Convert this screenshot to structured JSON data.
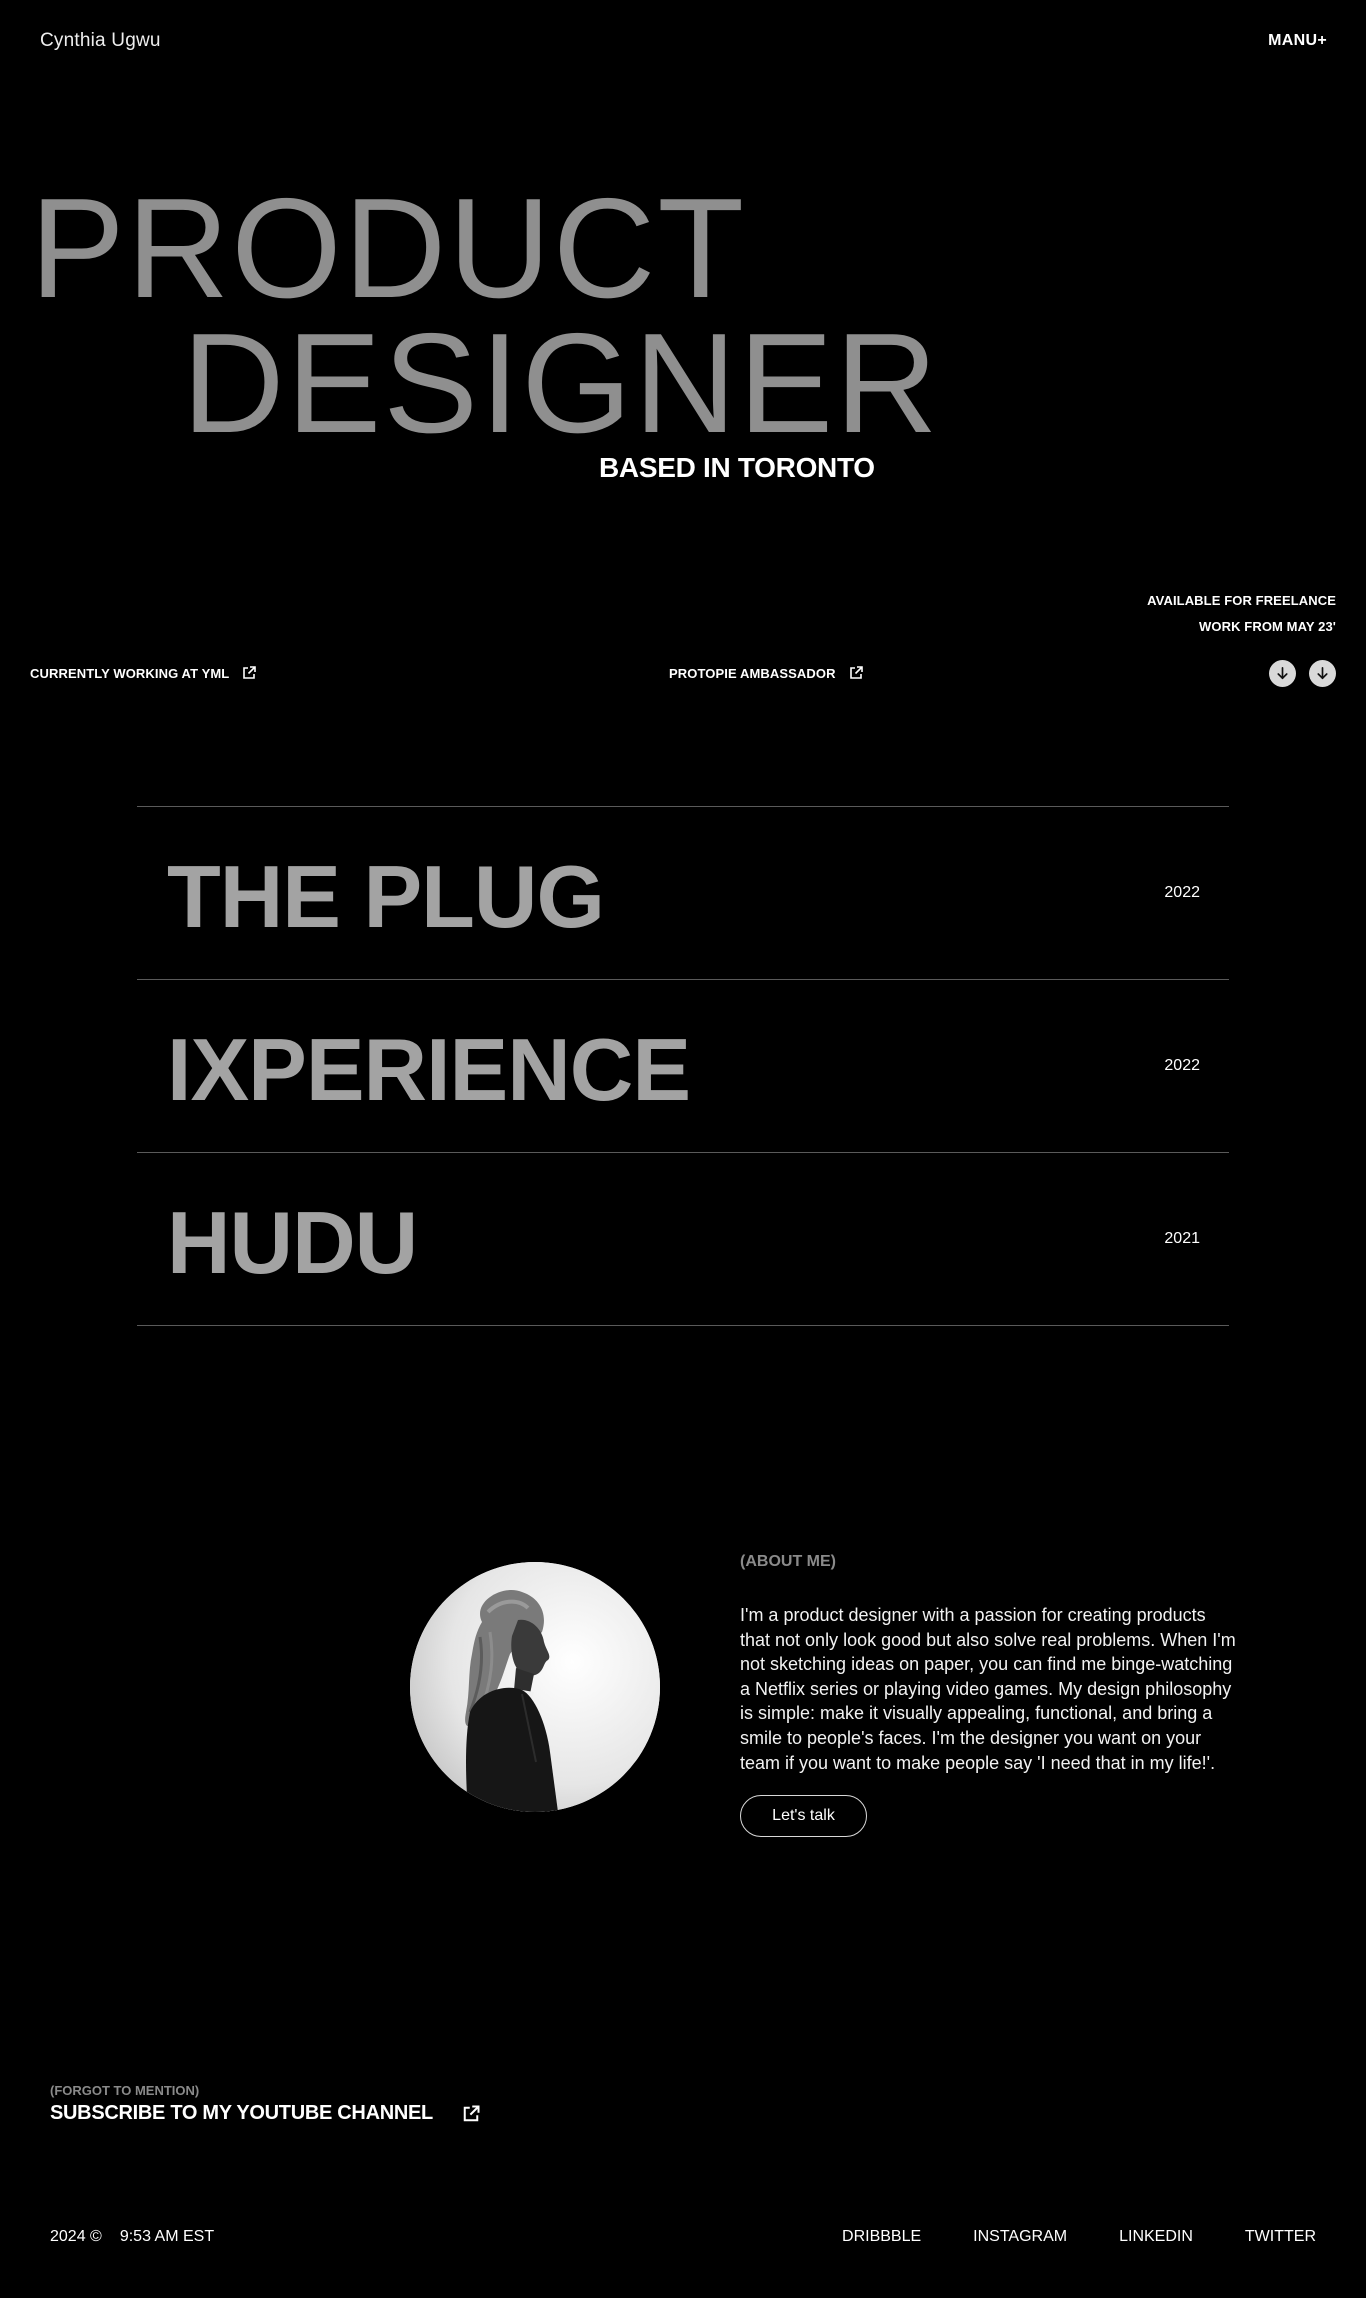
{
  "header": {
    "brand": "Cynthia Ugwu",
    "menu_label": "MANU+"
  },
  "hero": {
    "line1": "PRODUCT",
    "line2": "DESIGNER",
    "subtitle": "BASED IN TORONTO"
  },
  "status": {
    "available_line1": "AVAILABLE FOR FREELANCE",
    "available_line2": "WORK FROM MAY 23'",
    "working_at": "CURRENTLY WORKING AT YML",
    "ambassador": "PROTOPIE AMBASSADOR"
  },
  "icons": {
    "external": "external-link-icon",
    "scroll": "arrow-down-icon"
  },
  "projects": [
    {
      "name": "THE PLUG",
      "year": "2022"
    },
    {
      "name": "IXPERIENCE",
      "year": "2022"
    },
    {
      "name": "HUDU",
      "year": "2021"
    }
  ],
  "about": {
    "tag": "(ABOUT ME)",
    "text": "I'm a product designer with a passion for creating products that not only look good but also solve real problems. When I'm not sketching ideas on paper, you can find me binge-watching a Netflix series or playing video games. My design philosophy is simple: make it visually appealing, functional, and bring a smile to people's faces. I'm the designer you want on your team if you want to make people say 'I need that in my life!'.",
    "cta": "Let's talk"
  },
  "footer": {
    "forgot": "(FORGOT TO MENTION)",
    "youtube": "SUBSCRIBE TO MY YOUTUBE CHANNEL",
    "year": "2024 ©",
    "time": "9:53 AM EST",
    "socials": [
      "DRIBBBLE",
      "INSTAGRAM",
      "LINKEDIN",
      "TWITTER"
    ]
  },
  "colors": {
    "background": "#000000",
    "hero_text": "#8f8f8f",
    "project_text": "#a3a3a3",
    "divider": "#5a5a5a"
  }
}
